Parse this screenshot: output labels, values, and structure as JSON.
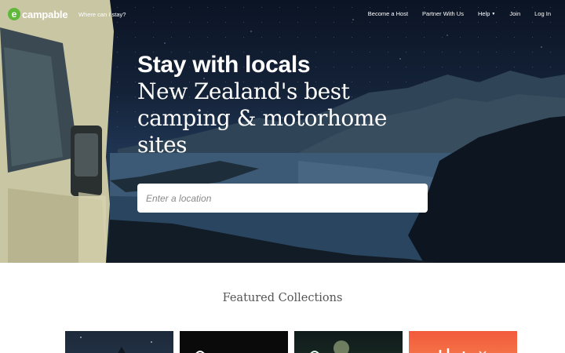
{
  "brand": {
    "name": "campable",
    "mark": "e"
  },
  "nav": {
    "where_link": "Where can I stay?",
    "links": [
      {
        "label": "Become a Host"
      },
      {
        "label": "Partner With Us"
      },
      {
        "label": "Help"
      },
      {
        "label": "Join"
      },
      {
        "label": "Log In"
      }
    ],
    "help_caret": "▼"
  },
  "hero": {
    "title": "Stay with locals",
    "subtitle_line1": "New Zealand's best",
    "subtitle_line2": "camping & motorhome",
    "subtitle_line3": "sites",
    "search_placeholder": "Enter a location"
  },
  "featured": {
    "title": "Featured Collections"
  },
  "colors": {
    "brand_green": "#5fb83a",
    "night_sky": "#142238",
    "card_orange": "#f25a3c"
  }
}
